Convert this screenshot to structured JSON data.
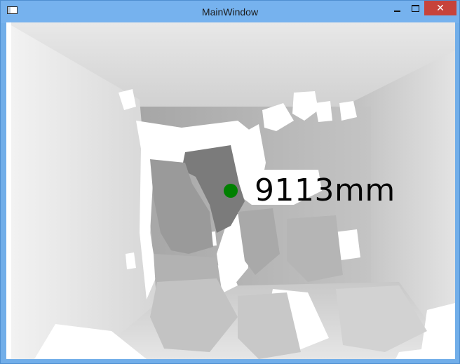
{
  "window": {
    "title": "MainWindow",
    "close_symbol": "✕"
  },
  "depth_view": {
    "distance_readout": "9113mm",
    "marker_color": "#008000"
  }
}
